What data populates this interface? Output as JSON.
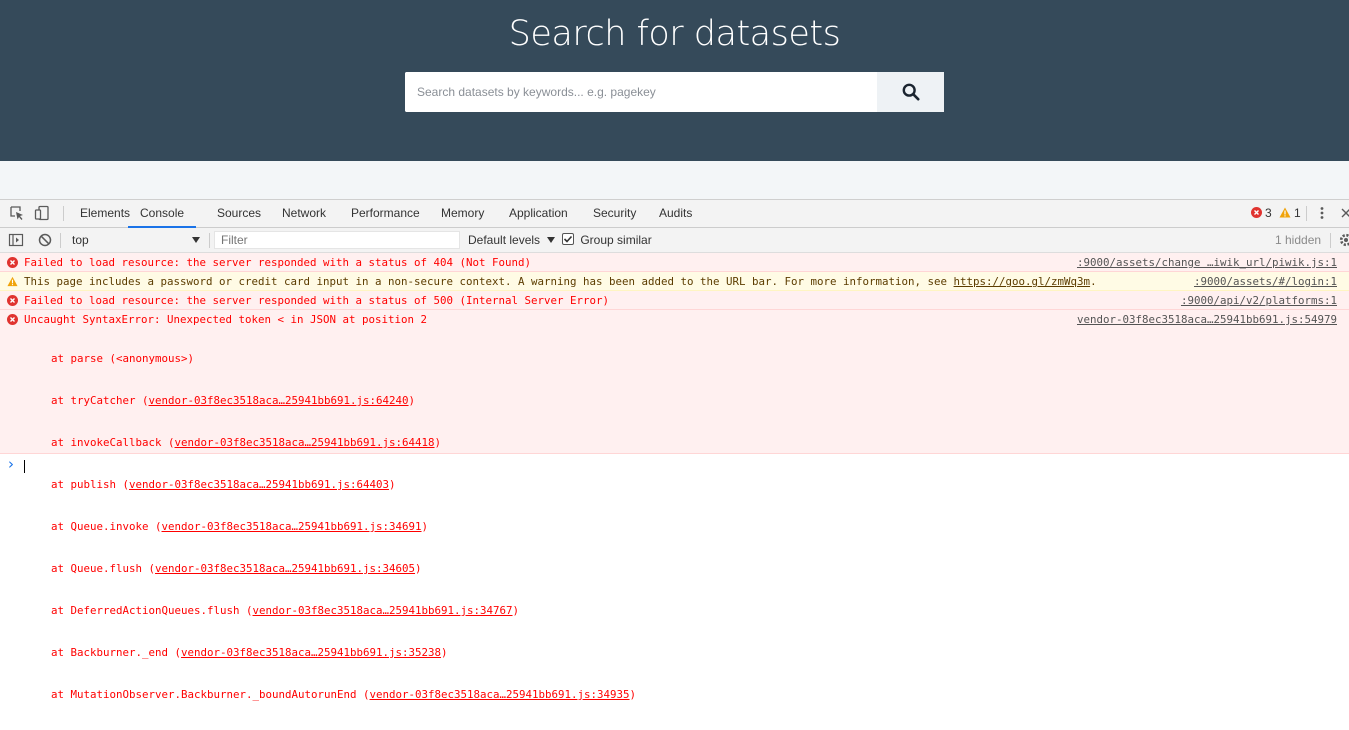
{
  "hero": {
    "title": "Search for datasets",
    "search_placeholder": "Search datasets by keywords... e.g. pagekey"
  },
  "devtools": {
    "tabs": [
      "Elements",
      "Console",
      "Sources",
      "Network",
      "Performance",
      "Memory",
      "Application",
      "Security",
      "Audits"
    ],
    "active_tab": "Console",
    "error_count": "3",
    "warning_count": "1",
    "toolbar": {
      "context": "top",
      "filter_placeholder": "Filter",
      "levels": "Default levels",
      "group_similar": "Group similar",
      "hidden": "1 hidden"
    },
    "messages": [
      {
        "level": "error",
        "text": "Failed to load resource: the server responded with a status of 404 (Not Found)",
        "source": ":9000/assets/change …iwik_url/piwik.js:1"
      },
      {
        "level": "warning",
        "text": "This page includes a password or credit card input in a non-secure context. A warning has been added to the URL bar. For more information, see ",
        "link": "https://goo.gl/zmWq3m",
        "tail": ".",
        "source": ":9000/assets/#/login:1"
      },
      {
        "level": "error",
        "text": "Failed to load resource: the server responded with a status of 500 (Internal Server Error)",
        "source": ":9000/api/v2/platforms:1"
      },
      {
        "level": "error",
        "text": "Uncaught SyntaxError: Unexpected token < in JSON at position 2",
        "source": "vendor-03f8ec3518aca…25941bb691.js:54979"
      }
    ],
    "stack": [
      {
        "fn": "at parse (<anonymous>)",
        "file": ""
      },
      {
        "fn": "at tryCatcher (",
        "file": "vendor-03f8ec3518aca…25941bb691.js:64240"
      },
      {
        "fn": "at invokeCallback (",
        "file": "vendor-03f8ec3518aca…25941bb691.js:64418"
      },
      {
        "fn": "at publish (",
        "file": "vendor-03f8ec3518aca…25941bb691.js:64403"
      },
      {
        "fn": "at Queue.invoke (",
        "file": "vendor-03f8ec3518aca…25941bb691.js:34691"
      },
      {
        "fn": "at Queue.flush (",
        "file": "vendor-03f8ec3518aca…25941bb691.js:34605"
      },
      {
        "fn": "at DeferredActionQueues.flush (",
        "file": "vendor-03f8ec3518aca…25941bb691.js:34767"
      },
      {
        "fn": "at Backburner._end (",
        "file": "vendor-03f8ec3518aca…25941bb691.js:35238"
      },
      {
        "fn": "at MutationObserver.Backburner._boundAutorunEnd (",
        "file": "vendor-03f8ec3518aca…25941bb691.js:34935"
      }
    ],
    "prompt_symbol": "›"
  },
  "colors": {
    "hero_bg": "#354a5a",
    "error": "#ff0000",
    "error_bg": "#fff0f0",
    "warning_bg": "#fffbe5",
    "accent": "#1a73e8"
  }
}
